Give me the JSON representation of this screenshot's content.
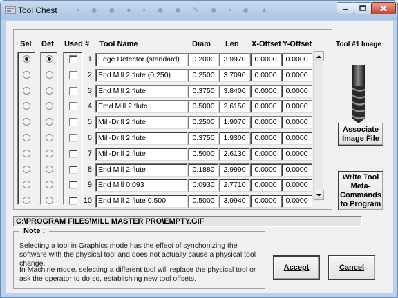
{
  "window": {
    "title": "Tool Chest",
    "controls": [
      "minimize",
      "maximize",
      "close"
    ]
  },
  "table": {
    "headers": {
      "sel": "Sel",
      "def": "Def",
      "used": "Used #",
      "name": "Tool Name",
      "diam": "Diam",
      "len": "Len",
      "xoff": "X-Offset",
      "yoff": "Y-Offset"
    },
    "rows": [
      {
        "num": "1",
        "name": "Edge Detector (standard)",
        "diam": "0.2000",
        "len": "3.9970",
        "xoff": "0.0000",
        "yoff": "0.0000",
        "sel": true,
        "def": true,
        "used": false
      },
      {
        "num": "2",
        "name": "End Mill  2 flute (0.250)",
        "diam": "0.2500",
        "len": "3.7090",
        "xoff": "0.0000",
        "yoff": "0.0000",
        "sel": false,
        "def": false,
        "used": false
      },
      {
        "num": "3",
        "name": "End Mill 2 flute",
        "diam": "0.3750",
        "len": "3.8400",
        "xoff": "0.0000",
        "yoff": "0.0000",
        "sel": false,
        "def": false,
        "used": false
      },
      {
        "num": "4",
        "name": "Emd Mill 2 flute",
        "diam": "0.5000",
        "len": "2.6150",
        "xoff": "0.0000",
        "yoff": "0.0000",
        "sel": false,
        "def": false,
        "used": false
      },
      {
        "num": "5",
        "name": "Mill-Drill  2 flute",
        "diam": "0.2500",
        "len": "1.9070",
        "xoff": "0.0000",
        "yoff": "0.0000",
        "sel": false,
        "def": false,
        "used": false
      },
      {
        "num": "6",
        "name": "Mill-Drill 2 flute",
        "diam": "0.3750",
        "len": "1.9300",
        "xoff": "0.0000",
        "yoff": "0.0000",
        "sel": false,
        "def": false,
        "used": false
      },
      {
        "num": "7",
        "name": "Mill-Drill 2 flute",
        "diam": "0.5000",
        "len": "2.6130",
        "xoff": "0.0000",
        "yoff": "0.0000",
        "sel": false,
        "def": false,
        "used": false
      },
      {
        "num": "8",
        "name": "End Mill 2 flute",
        "diam": "0.1880",
        "len": "2.9990",
        "xoff": "0.0000",
        "yoff": "0.0000",
        "sel": false,
        "def": false,
        "used": false
      },
      {
        "num": "9",
        "name": "End Mill   0.093",
        "diam": "0.0930",
        "len": "2.7710",
        "xoff": "0.0000",
        "yoff": "0.0000",
        "sel": false,
        "def": false,
        "used": false
      },
      {
        "num": "10",
        "name": "End Mill 2 flute 0.500",
        "diam": "0.5000",
        "len": "3.9940",
        "xoff": "0.0000",
        "yoff": "0.0000",
        "sel": false,
        "def": false,
        "used": false
      }
    ]
  },
  "path": "C:\\PROGRAM FILES\\MILL MASTER PRO\\EMPTY.GIF",
  "note": {
    "title": "Note :",
    "para1": "Selecting a tool in Graphics mode has the effect of synchonizing the software with the physical tool and does not actually cause a physical tool change.",
    "para2": "In Machine mode, selecting a different tool will replace the physical tool or ask the operator to do so, establishing new tool offsets."
  },
  "tool_image": {
    "label": "Tool #1 Image",
    "icon": "end-mill-icon"
  },
  "buttons": {
    "associate": "Associate Image File",
    "write_tool": "Write Tool Meta-Commands to Program",
    "accept": "Accept",
    "cancel": "Cancel"
  }
}
